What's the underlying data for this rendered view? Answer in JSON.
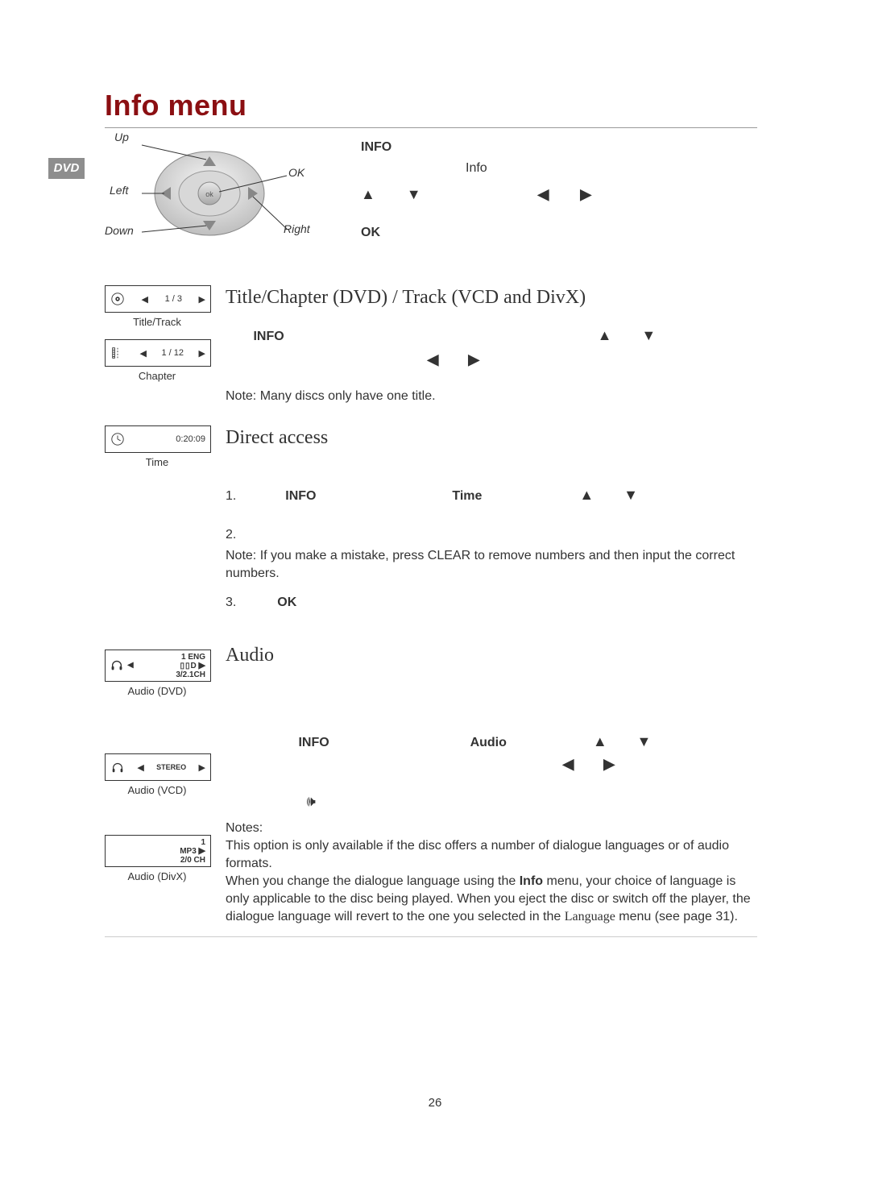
{
  "page_title": "Info menu",
  "dvd_tag": "DVD",
  "page_number": "26",
  "remote": {
    "up": "Up",
    "left": "Left",
    "down": "Down",
    "right": "Right",
    "ok": "OK"
  },
  "intro": {
    "info_label": "INFO",
    "info_word": "Info",
    "ok": "OK"
  },
  "boxes": {
    "title_track": {
      "value": "1 / 3",
      "caption": "Title/Track"
    },
    "chapter": {
      "value": "1 / 12",
      "caption": "Chapter"
    },
    "time": {
      "value": "0:20:09",
      "caption": "Time"
    },
    "audio_dvd": {
      "line1": "1 ENG",
      "line2": "D",
      "line3": "3/2.1CH",
      "caption": "Audio (DVD)"
    },
    "audio_vcd": {
      "value": "STEREO",
      "caption": "Audio (VCD)"
    },
    "audio_divx": {
      "line1": "1",
      "line2": "MP3",
      "line3": "2/0 CH",
      "caption": "Audio (DivX)"
    }
  },
  "sections": {
    "title": {
      "heading": "Title/Chapter (DVD) / Track (VCD and DivX)",
      "info": "INFO",
      "note": "Note: Many discs only have one title."
    },
    "direct": {
      "heading": "Direct access",
      "step1_num": "1.",
      "step1_info": "INFO",
      "step1_time": "Time",
      "step2_num": "2.",
      "step2_note": "Note: If you make a mistake, press CLEAR  to remove numbers and then input the correct numbers.",
      "step3_num": "3.",
      "step3_ok": "OK"
    },
    "audio": {
      "heading": "Audio",
      "info": "INFO",
      "audio_word": "Audio",
      "notes_label": "Notes:",
      "note1": "This option is only available if the disc offers a number of dialogue languages or of audio formats.",
      "note2a": "When you change the dialogue language using the ",
      "note2b": "Info",
      "note2c": " menu, your choice of language is only applicable to the disc being played. When you eject the disc or switch off the player, the dialogue language will revert to the one you selected in the ",
      "note2d": "Language",
      "note2e": " menu (see page 31)."
    }
  }
}
